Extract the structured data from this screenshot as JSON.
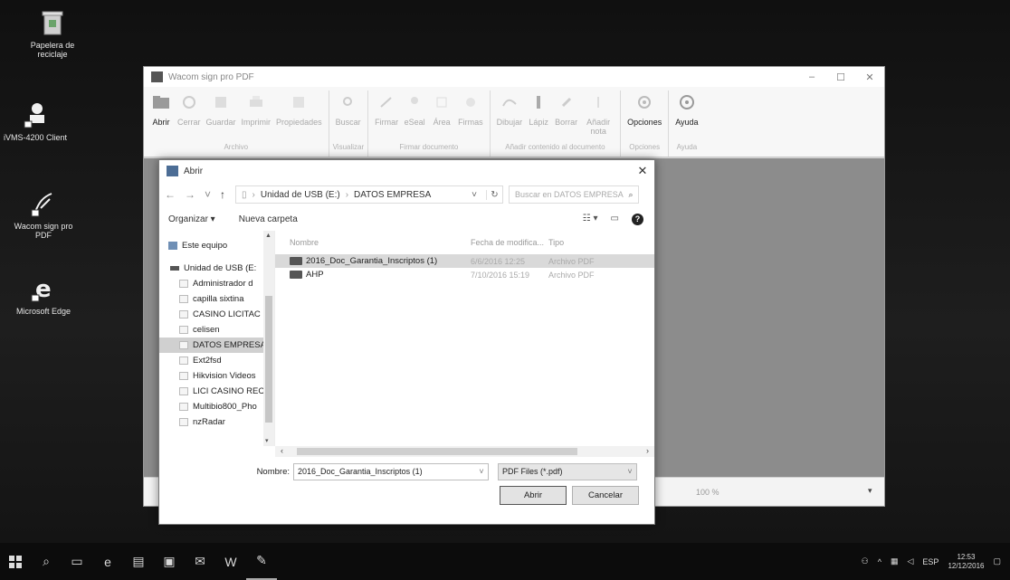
{
  "desktop": {
    "icons": [
      {
        "name": "recycle-bin",
        "label": "Papelera de reciclaje"
      },
      {
        "name": "ivms-client",
        "label": "iVMS-4200 Client"
      },
      {
        "name": "wacom-sign-pro",
        "label": "Wacom sign pro PDF"
      },
      {
        "name": "microsoft-edge",
        "label": "Microsoft Edge"
      }
    ]
  },
  "app": {
    "title": "Wacom sign pro PDF",
    "window_controls": [
      "–",
      "☐",
      "✕"
    ],
    "ribbon": {
      "groups": [
        {
          "name": "Archivo",
          "buttons": [
            "Abrir",
            "Cerrar",
            "Guardar",
            "Imprimir",
            "Propiedades"
          ]
        },
        {
          "name": "Visualizar",
          "buttons": [
            "Buscar"
          ]
        },
        {
          "name": "Firmar documento",
          "buttons": [
            "Firmar",
            "eSeal",
            "Área",
            "Firmas"
          ]
        },
        {
          "name": "Añadir contenido al documento",
          "buttons": [
            "Dibujar",
            "Lápiz",
            "Borrar",
            "Añadir nota"
          ]
        },
        {
          "name": "Opciones",
          "buttons": [
            "Opciones"
          ]
        },
        {
          "name": "Ayuda",
          "buttons": [
            "Ayuda"
          ]
        }
      ]
    },
    "status": {
      "zoom": "100 %",
      "zoom_arrow": "▾"
    }
  },
  "dialog": {
    "title": "Abrir",
    "close": "✕",
    "nav": {
      "back": "←",
      "forward": "→",
      "recent": "˅",
      "up": "↑"
    },
    "breadcrumb": [
      "Unidad de USB (E:)",
      "DATOS EMPRESA"
    ],
    "breadcrumb_sep": "›",
    "breadcrumb_dropdown": "˅",
    "refresh": "↻",
    "search_placeholder": "Buscar en DATOS EMPRESA",
    "search_icon": "⌕",
    "toolbar": {
      "organize": "Organizar ▾",
      "new_folder": "Nueva carpeta",
      "view": "☷ ▾",
      "preview": "▭",
      "help": "?"
    },
    "nav_pane": [
      {
        "label": "Este equipo",
        "kind": "pc"
      },
      {
        "label": "Unidad de USB (E:",
        "kind": "usb"
      },
      {
        "label": "Administrador d",
        "kind": "folder"
      },
      {
        "label": "capilla sixtina",
        "kind": "folder"
      },
      {
        "label": "CASINO LICITAC",
        "kind": "folder"
      },
      {
        "label": "celisen",
        "kind": "folder"
      },
      {
        "label": "DATOS EMPRESA",
        "kind": "folder",
        "selected": true
      },
      {
        "label": "Ext2fsd",
        "kind": "folder"
      },
      {
        "label": "Hikvision Videos",
        "kind": "folder"
      },
      {
        "label": "LICI CASINO REC",
        "kind": "folder"
      },
      {
        "label": "Multibio800_Pho",
        "kind": "folder"
      },
      {
        "label": "nzRadar",
        "kind": "folder"
      }
    ],
    "columns": {
      "name": "Nombre",
      "modified": "Fecha de modifica...",
      "type": "Tipo"
    },
    "files": [
      {
        "name": "2016_Doc_Garantia_Inscriptos (1)",
        "modified": "6/6/2016 12:25",
        "type": "Archivo PDF",
        "selected": true
      },
      {
        "name": "AHP",
        "modified": "7/10/2016 15:19",
        "type": "Archivo PDF"
      }
    ],
    "scroll": {
      "left": "‹",
      "right": "›",
      "nav_down": "▾"
    },
    "filename_label": "Nombre:",
    "filename_value": "2016_Doc_Garantia_Inscriptos (1)",
    "filename_dropdown": "˅",
    "filetype": "PDF Files (*.pdf)",
    "filetype_dropdown": "˅",
    "open_button": "Abrir",
    "cancel_button": "Cancelar"
  },
  "taskbar": {
    "tray_text": "ESP",
    "time": "12:53",
    "date": "12/12/2016",
    "up_arrow": "^"
  }
}
